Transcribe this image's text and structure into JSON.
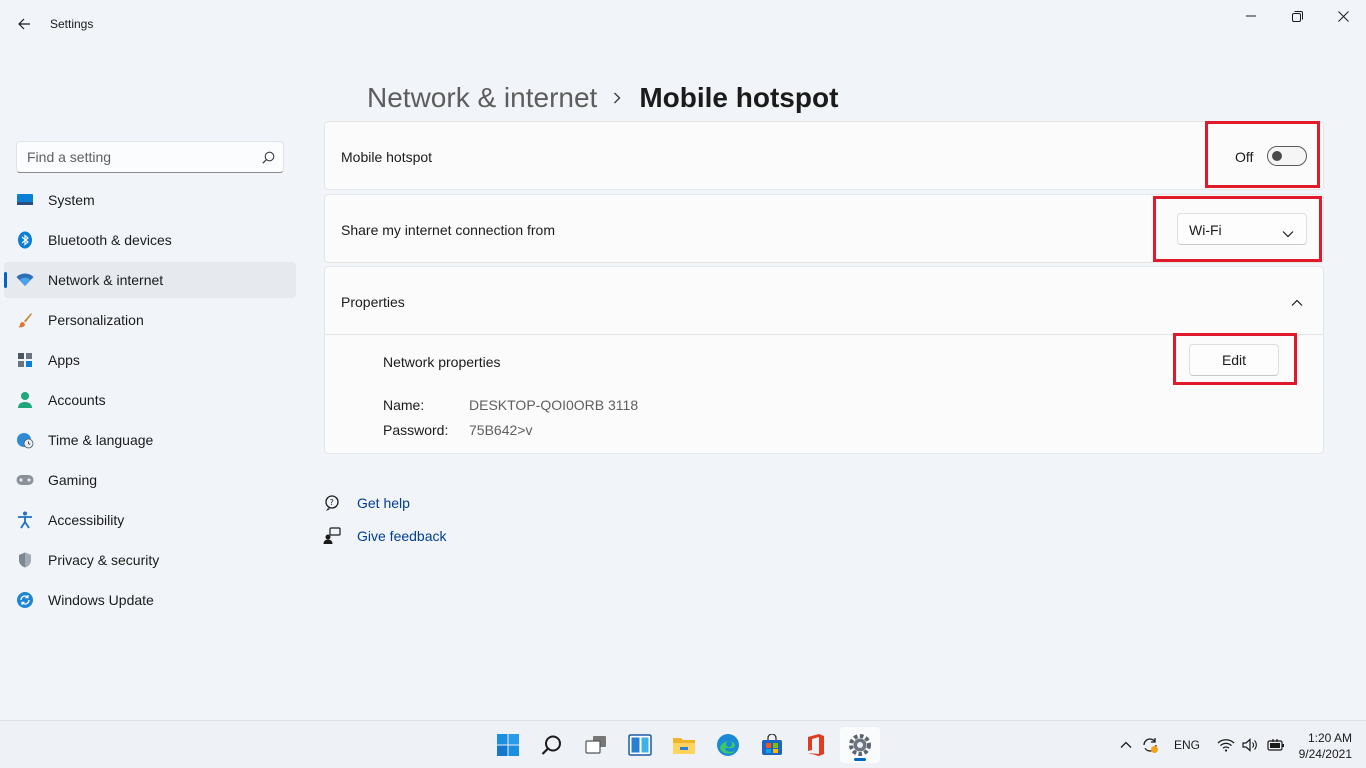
{
  "window": {
    "title": "Settings"
  },
  "search": {
    "placeholder": "Find a setting"
  },
  "sidebar": {
    "items": [
      {
        "label": "System",
        "icon": "system-icon"
      },
      {
        "label": "Bluetooth & devices",
        "icon": "bluetooth-icon"
      },
      {
        "label": "Network & internet",
        "icon": "wifi-icon",
        "active": true
      },
      {
        "label": "Personalization",
        "icon": "brush-icon"
      },
      {
        "label": "Apps",
        "icon": "apps-icon"
      },
      {
        "label": "Accounts",
        "icon": "person-icon"
      },
      {
        "label": "Time & language",
        "icon": "globe-clock-icon"
      },
      {
        "label": "Gaming",
        "icon": "gamepad-icon"
      },
      {
        "label": "Accessibility",
        "icon": "accessibility-icon"
      },
      {
        "label": "Privacy & security",
        "icon": "shield-icon"
      },
      {
        "label": "Windows Update",
        "icon": "update-icon"
      }
    ]
  },
  "breadcrumb": {
    "parent": "Network & internet",
    "current": "Mobile hotspot"
  },
  "hotspot": {
    "label": "Mobile hotspot",
    "state_text": "Off",
    "enabled": false
  },
  "share": {
    "label": "Share my internet connection from",
    "selected": "Wi-Fi"
  },
  "properties": {
    "header": "Properties",
    "network_properties": "Network properties",
    "edit_label": "Edit",
    "name_key": "Name:",
    "name_value": "DESKTOP-QOI0ORB 3118",
    "password_key": "Password:",
    "password_value": "75B642>v"
  },
  "help": {
    "get_help": "Get help",
    "give_feedback": "Give feedback"
  },
  "taskbar": {
    "language": "ENG",
    "time": "1:20 AM",
    "date": "9/24/2021"
  },
  "colors": {
    "accent": "#0067c0",
    "highlight": "#e0192b",
    "link": "#003e92"
  }
}
